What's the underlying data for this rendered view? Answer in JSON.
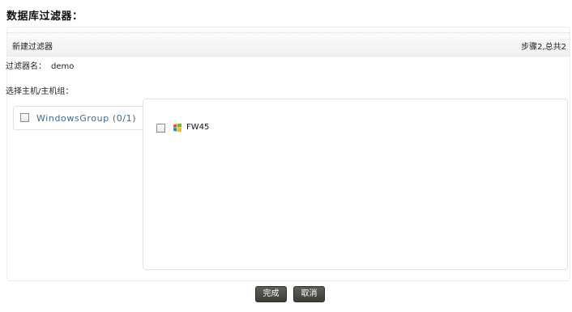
{
  "page": {
    "title": "数据库过滤器："
  },
  "wizard": {
    "title": "新建过滤器",
    "step": "步骤2,总共2",
    "filter_name_label": "过滤器名：",
    "filter_name_value": "demo",
    "select_label": "选择主机/主机组："
  },
  "groups": [
    {
      "label": "WindowsGroup (0/1)",
      "checked": false
    }
  ],
  "hosts": [
    {
      "name": "FW45",
      "icon": "windows-icon",
      "checked": false
    }
  ],
  "buttons": {
    "finish": "完成",
    "cancel": "取消"
  },
  "colors": {
    "button_bg": "#4a4a42",
    "group_link": "#3a6a8e"
  }
}
